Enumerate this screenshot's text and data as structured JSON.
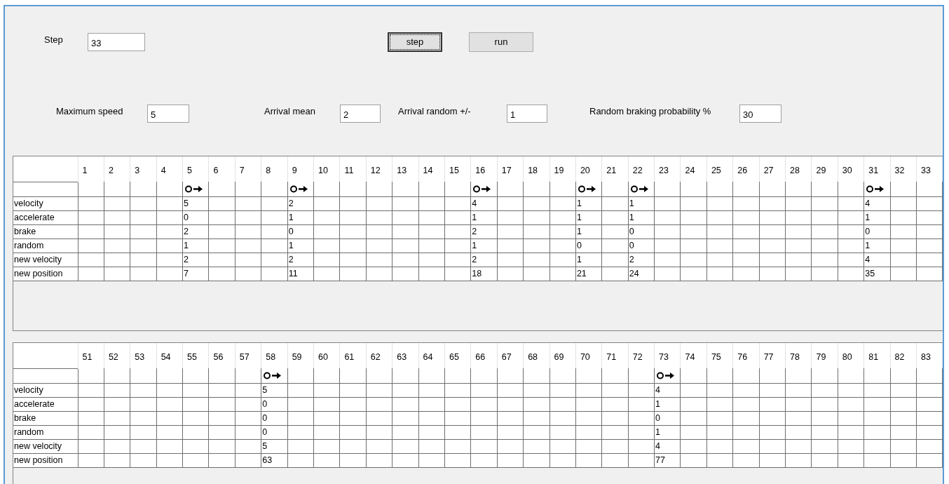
{
  "step": {
    "label": "Step",
    "value": "33"
  },
  "buttons": [
    {
      "label": "step",
      "focused": true
    },
    {
      "label": "run",
      "focused": false
    }
  ],
  "parameters": [
    {
      "label": "Maximum speed",
      "value": "5"
    },
    {
      "label": "Arrival mean",
      "value": "2"
    },
    {
      "label": "Arrival random +/-",
      "value": "1"
    },
    {
      "label": "Random braking probability %",
      "value": "30"
    }
  ],
  "tables": [
    {
      "row_labels": [
        "velocity",
        "accelerate",
        "brake",
        "random",
        "new velocity",
        "new position"
      ],
      "columns": [
        {
          "label": "1"
        },
        {
          "label": "2"
        },
        {
          "label": "3"
        },
        {
          "label": "4"
        },
        {
          "label": "5",
          "car": [
            "5",
            "0",
            "2",
            "1",
            "2",
            "7"
          ]
        },
        {
          "label": "6"
        },
        {
          "label": "7"
        },
        {
          "label": "8"
        },
        {
          "label": "9",
          "car": [
            "2",
            "1",
            "0",
            "1",
            "2",
            "11"
          ]
        },
        {
          "label": "10"
        },
        {
          "label": "11"
        },
        {
          "label": "12"
        },
        {
          "label": "13"
        },
        {
          "label": "14"
        },
        {
          "label": "15"
        },
        {
          "label": "16",
          "car": [
            "4",
            "1",
            "2",
            "1",
            "2",
            "18"
          ]
        },
        {
          "label": "17"
        },
        {
          "label": "18"
        },
        {
          "label": "19"
        },
        {
          "label": "20",
          "car": [
            "1",
            "1",
            "1",
            "0",
            "1",
            "21"
          ]
        },
        {
          "label": "21"
        },
        {
          "label": "22",
          "car": [
            "1",
            "1",
            "0",
            "0",
            "2",
            "24"
          ]
        },
        {
          "label": "23"
        },
        {
          "label": "24"
        },
        {
          "label": "25"
        },
        {
          "label": "26"
        },
        {
          "label": "27"
        },
        {
          "label": "28"
        },
        {
          "label": "29"
        },
        {
          "label": "30"
        },
        {
          "label": "31",
          "car": [
            "4",
            "1",
            "0",
            "1",
            "4",
            "35"
          ]
        },
        {
          "label": "32"
        },
        {
          "label": "33"
        }
      ]
    },
    {
      "row_labels": [
        "velocity",
        "accelerate",
        "brake",
        "random",
        "new velocity",
        "new position"
      ],
      "columns": [
        {
          "label": "51"
        },
        {
          "label": "52"
        },
        {
          "label": "53"
        },
        {
          "label": "54"
        },
        {
          "label": "55"
        },
        {
          "label": "56"
        },
        {
          "label": "57"
        },
        {
          "label": "58",
          "car": [
            "5",
            "0",
            "0",
            "0",
            "5",
            "63"
          ]
        },
        {
          "label": "59"
        },
        {
          "label": "60"
        },
        {
          "label": "61"
        },
        {
          "label": "62"
        },
        {
          "label": "63"
        },
        {
          "label": "64"
        },
        {
          "label": "65"
        },
        {
          "label": "66"
        },
        {
          "label": "67"
        },
        {
          "label": "68"
        },
        {
          "label": "69"
        },
        {
          "label": "70"
        },
        {
          "label": "71"
        },
        {
          "label": "72"
        },
        {
          "label": "73",
          "car": [
            "4",
            "1",
            "0",
            "1",
            "4",
            "77"
          ]
        },
        {
          "label": "74"
        },
        {
          "label": "75"
        },
        {
          "label": "76"
        },
        {
          "label": "77"
        },
        {
          "label": "78"
        },
        {
          "label": "79"
        },
        {
          "label": "80"
        },
        {
          "label": "81"
        },
        {
          "label": "82"
        },
        {
          "label": "83"
        }
      ]
    }
  ]
}
